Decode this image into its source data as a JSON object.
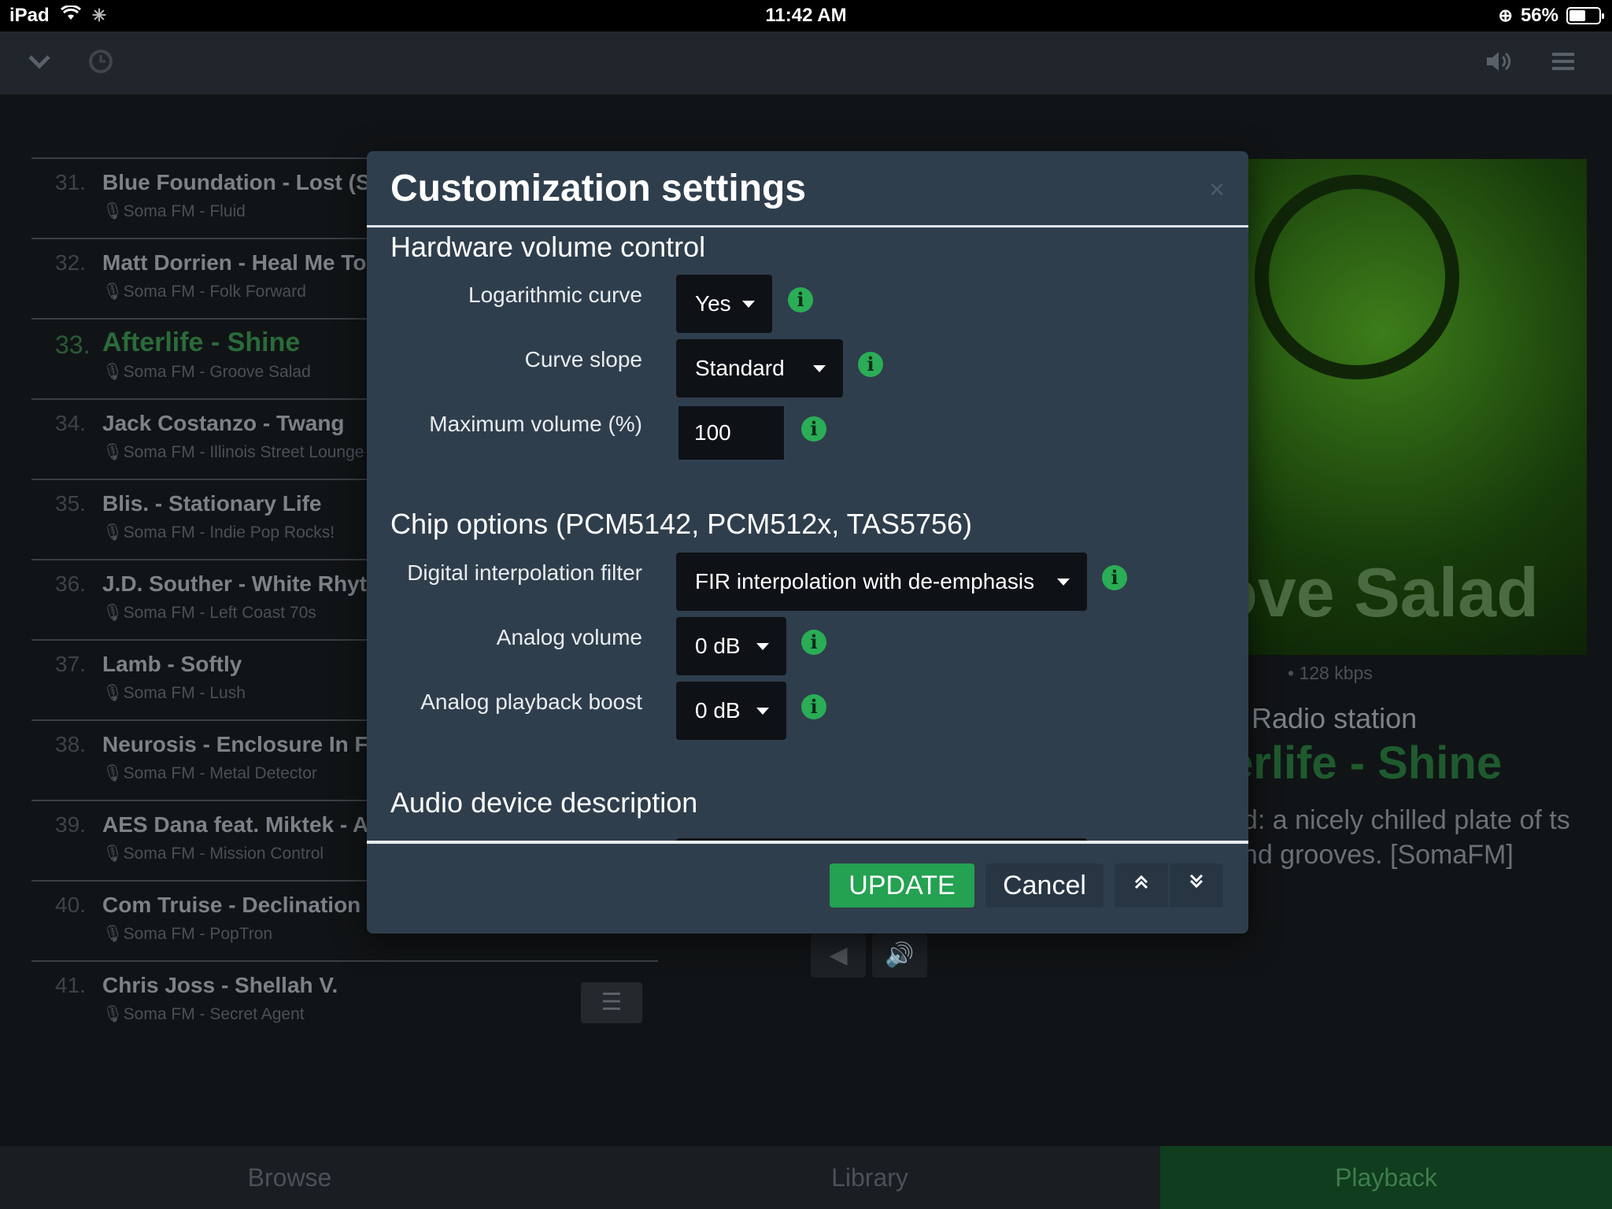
{
  "status_bar": {
    "device": "iPad",
    "time": "11:42 AM",
    "battery": "56%",
    "battery_level": 0.56
  },
  "background": {
    "queue": [
      {
        "num": "31.",
        "title": "Blue Foundation - Lost (Sun",
        "station": "Soma FM - Fluid"
      },
      {
        "num": "32.",
        "title": "Matt Dorrien - Heal Me Tor",
        "station": "Soma FM - Folk Forward"
      },
      {
        "num": "33.",
        "title": "Afterlife - Shine",
        "station": "Soma FM - Groove Salad"
      },
      {
        "num": "34.",
        "title": "Jack Costanzo - Twang",
        "station": "Soma FM - Illinois Street Lounge"
      },
      {
        "num": "35.",
        "title": "Blis. - Stationary Life",
        "station": "Soma FM - Indie Pop Rocks!"
      },
      {
        "num": "36.",
        "title": "J.D. Souther - White Rhythm",
        "station": "Soma FM - Left Coast 70s"
      },
      {
        "num": "37.",
        "title": "Lamb - Softly",
        "station": "Soma FM - Lush"
      },
      {
        "num": "38.",
        "title": "Neurosis - Enclosure In Flan",
        "station": "Soma FM - Metal Detector"
      },
      {
        "num": "39.",
        "title": "AES Dana feat. Miktek - Alk",
        "station": "Soma FM - Mission Control"
      },
      {
        "num": "40.",
        "title": "Com Truise - Declination (In",
        "station": "Soma FM - PopTron"
      },
      {
        "num": "41.",
        "title": "Chris Joss - Shellah V.",
        "station": "Soma FM - Secret Agent"
      }
    ],
    "now_playing": {
      "art_text": "ove Salad",
      "bitrate": "• 128 kbps",
      "label": "Radio station",
      "title": "erlife - Shine",
      "description": "ad: a nicely chilled plate of ts and grooves. [SomaFM]"
    }
  },
  "tabs": [
    "Browse",
    "Library",
    "Playback"
  ],
  "modal": {
    "title": "Customization settings",
    "close_glyph": "×",
    "sections": {
      "hardware": "Hardware volume control",
      "chip": "Chip options (PCM5142, PCM512x, TAS5756)",
      "audio": "Audio device description"
    },
    "fields": {
      "log_curve": {
        "label": "Logarithmic curve",
        "value": "Yes"
      },
      "curve_slope": {
        "label": "Curve slope",
        "value": "Standard"
      },
      "max_volume": {
        "label": "Maximum volume (%)",
        "value": "100"
      },
      "interp_filter": {
        "label": "Digital interpolation filter",
        "value": "FIR interpolation with de-emphasis"
      },
      "analog_volume": {
        "label": "Analog volume",
        "value": "0 dB"
      },
      "analog_boost": {
        "label": "Analog playback boost",
        "value": "0 dB"
      }
    },
    "buttons": {
      "update": "UPDATE",
      "cancel": "Cancel"
    }
  },
  "colors": {
    "accent_green": "#24a151",
    "modal_bg": "#2f3e4c",
    "field_bg": "#0e1216"
  }
}
